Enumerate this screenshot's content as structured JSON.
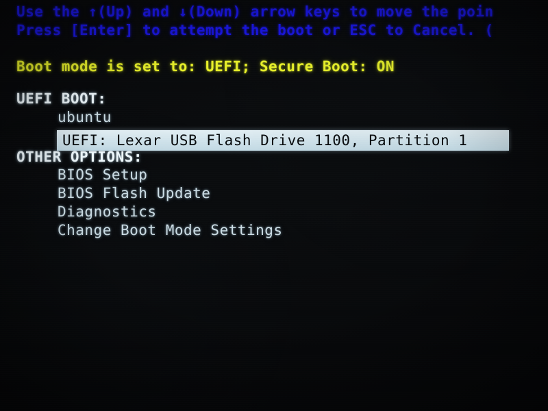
{
  "screen": {
    "kind": "uefi-one-time-boot-menu",
    "background_color": "#000000"
  },
  "instructions": {
    "line1": "Use the ↑(Up) and ↓(Down) arrow keys to move the poin",
    "line2": "Press [Enter] to attempt the boot or ESC to Cancel. (",
    "color": "#1a16e6"
  },
  "status": {
    "text": "Boot mode is set to: UEFI; Secure Boot: ON",
    "boot_mode": "UEFI",
    "secure_boot": "ON",
    "color": "#e8f02a"
  },
  "uefi_boot": {
    "header": "UEFI BOOT:",
    "items": [
      {
        "label": "ubuntu",
        "selected": false
      },
      {
        "label": "UEFI: Lexar USB Flash Drive 1100, Partition 1",
        "selected": true
      }
    ]
  },
  "other_options": {
    "header": "OTHER OPTIONS:",
    "items": [
      {
        "label": "BIOS Setup",
        "selected": false
      },
      {
        "label": "BIOS Flash Update",
        "selected": false
      },
      {
        "label": "Diagnostics",
        "selected": false
      },
      {
        "label": "Change Boot Mode Settings",
        "selected": false
      }
    ]
  },
  "colors": {
    "header_text": "#f2fbff",
    "entry_text": "#cfe0e8",
    "selection_background": "#d2e4ec",
    "selection_text": "#070a0c"
  }
}
